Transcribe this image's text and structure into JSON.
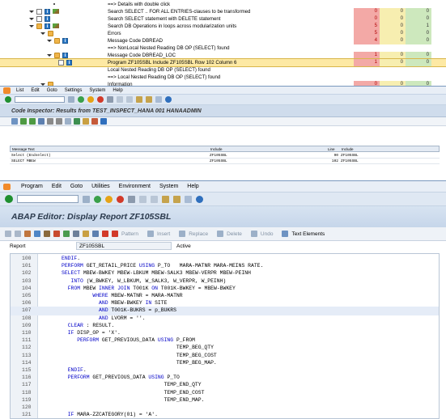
{
  "tree": {
    "rows": [
      {
        "text": "==> Details with double click",
        "counts": null,
        "icons": [
          "dot"
        ],
        "indent": 66
      },
      {
        "text": "Search SELECT .. FOR ALL ENTRIES-clauses to be transformed",
        "counts": [
          "0",
          "0",
          "0"
        ],
        "icons": [
          "tri",
          "doc",
          "info",
          "pen"
        ],
        "indent": 36
      },
      {
        "text": "Search SELECT statement with DELETE statement",
        "counts": [
          "0",
          "0",
          "0"
        ],
        "icons": [
          "tri",
          "doc",
          "info"
        ],
        "indent": 36
      },
      {
        "text": "Search DB Operations in loops across modularization units",
        "counts": [
          "5",
          "0",
          "1"
        ],
        "icons": [
          "tri",
          "fold",
          "info",
          "pen"
        ],
        "indent": 36
      },
      {
        "text": "Errors",
        "counts": [
          "5",
          "0",
          "0"
        ],
        "icons": [
          "tri",
          "fold"
        ],
        "indent": 50
      },
      {
        "text": "Message Code DBREAD",
        "counts": [
          "4",
          "0",
          "0"
        ],
        "icons": [
          "tri",
          "fold",
          "info"
        ],
        "indent": 58
      },
      {
        "text": "==> NonLocal Nested Reading DB OP (SELECT) found",
        "counts": null,
        "icons": [],
        "indent": 80
      },
      {
        "text": "Message Code DBREAD_LOC",
        "counts": [
          "1",
          "0",
          "0"
        ],
        "icons": [
          "tri",
          "fold",
          "info"
        ],
        "indent": 58
      },
      {
        "text": "Program ZF105SBL Include ZF105SBL Row 102 Column 6",
        "counts": [
          "1",
          "0",
          "0"
        ],
        "icons": [
          "doc",
          "info"
        ],
        "indent": 72,
        "highlight": true
      },
      {
        "text": "Local Nested Reading DB OP (SELECT) found",
        "counts": null,
        "icons": [],
        "indent": 80
      },
      {
        "text": "==> Local Nested Reading DB OP (SELECT) found",
        "counts": null,
        "icons": [],
        "indent": 80
      },
      {
        "text": "Information",
        "counts": [
          "0",
          "0",
          "0"
        ],
        "icons": [
          "tri",
          "fold"
        ],
        "indent": 50
      }
    ]
  },
  "inspector": {
    "menu": [
      "List",
      "Edit",
      "Goto",
      "Settings",
      "System",
      "Help"
    ],
    "title": "Code Inspector: Results from TEST_INSPECT_HANA 001 HANAADMIN",
    "columns": [
      "Message Text",
      "Include",
      "Line",
      "Include"
    ],
    "rows": [
      {
        "text": "Select (Endselect)",
        "include": "ZF105SBL",
        "line": "90",
        "include2": "ZF105SBL"
      },
      {
        "text": "SELECT MBEW",
        "include": "ZF105SBL",
        "line": "102",
        "include2": "ZF105SBL"
      }
    ]
  },
  "editor": {
    "menu": [
      "Program",
      "Edit",
      "Goto",
      "Utilities",
      "Environment",
      "System",
      "Help"
    ],
    "title": "ABAP Editor: Display Report ZF105SBL",
    "toolbar": {
      "pattern": "Pattern",
      "insert": "Insert",
      "replace": "Replace",
      "delete": "Delete",
      "undo": "Undo",
      "text_elements": "Text Elements"
    },
    "report_label": "Report",
    "report_value": "ZF105SBL",
    "report_status": "Active",
    "lines": [
      {
        "no": "100",
        "text": "      ENDIF."
      },
      {
        "no": "101",
        "text": "      PERFORM GET_RETAIL_PRICE USING P_TO   MARA-MATNR MARA-MEINS RATE."
      },
      {
        "no": "102",
        "text": "      SELECT MBEW-BWKEY MBEW-LBKUM MBEW-SALK3 MBEW-VERPR MBEW-PEINH"
      },
      {
        "no": "103",
        "text": "         INTO (W_BWKEY, W_LBKUM, W_SALK3, W_VERPR, W_PEINH)"
      },
      {
        "no": "104",
        "text": "        FROM MBEW INNER JOIN T001K ON T001K-BWKEY = MBEW-BWKEY"
      },
      {
        "no": "105",
        "text": "                WHERE MBEW-MATNR = MARA-MATNR"
      },
      {
        "no": "106",
        "text": "                  AND MBEW-BWKEY IN SITE"
      },
      {
        "no": "107",
        "text": "                  AND T001K-BUKRS = p_BUKRS",
        "highlight": true
      },
      {
        "no": "108",
        "text": "                  AND LVORM = ''."
      },
      {
        "no": "109",
        "text": "        CLEAR : RESULT."
      },
      {
        "no": "110",
        "text": "        IF DISP_OP = 'X'."
      },
      {
        "no": "111",
        "text": "           PERFORM GET_PREVIOUS_DATA USING P_FROM"
      },
      {
        "no": "112",
        "text": "                                           TEMP_BEG_QTY"
      },
      {
        "no": "113",
        "text": "                                           TEMP_BEG_COST"
      },
      {
        "no": "114",
        "text": "                                           TEMP_BEG_MAP."
      },
      {
        "no": "115",
        "text": "        ENDIF."
      },
      {
        "no": "116",
        "text": "        PERFORM GET_PREVIOUS_DATA USING P_TO"
      },
      {
        "no": "117",
        "text": "                                       TEMP_END_QTY"
      },
      {
        "no": "118",
        "text": "                                       TEMP_END_COST"
      },
      {
        "no": "119",
        "text": "                                       TEMP_END_MAP."
      },
      {
        "no": "120",
        "text": ""
      },
      {
        "no": "121",
        "text": "        IF MARA-ZZCATEGORY(01) = 'A'."
      }
    ]
  },
  "colors": {
    "error": "#f3a9a6",
    "warning": "#f7eeb0",
    "info": "#cde8bd",
    "highlight": "#fde9a4",
    "keyword": "#0000c8"
  }
}
